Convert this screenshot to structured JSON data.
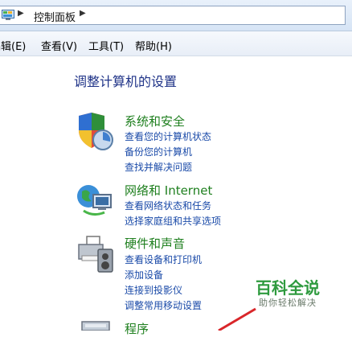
{
  "address_bar": {
    "location": "控制面板",
    "icon": "control-panel-icon"
  },
  "menu": {
    "items": [
      {
        "label": "编辑(E)"
      },
      {
        "label": "查看(V)"
      },
      {
        "label": "工具(T)"
      },
      {
        "label": "帮助(H)"
      }
    ]
  },
  "main": {
    "title": "调整计算机的设置",
    "categories": [
      {
        "heading": "系统和安全",
        "icon": "shield-security-icon",
        "links": [
          "查看您的计算机状态",
          "备份您的计算机",
          "查找并解决问题"
        ]
      },
      {
        "heading": "网络和 Internet",
        "icon": "network-globe-icon",
        "links": [
          "查看网络状态和任务",
          "选择家庭组和共享选项"
        ]
      },
      {
        "heading": "硬件和声音",
        "icon": "printer-speaker-icon",
        "links": [
          "查看设备和打印机",
          "添加设备",
          "连接到投影仪",
          "调整常用移动设置"
        ]
      },
      {
        "heading": "程序",
        "icon": "programs-icon",
        "links": []
      }
    ]
  },
  "watermark": {
    "title": "百科全说",
    "subtitle": "助你轻松解决",
    "colors": {
      "title": "#2e9a3e"
    }
  },
  "colors": {
    "heading_green": "#1e7f1e",
    "link_blue": "#1a4aa8",
    "title_blue": "#1e3287",
    "annotation_red": "#d9262a"
  }
}
